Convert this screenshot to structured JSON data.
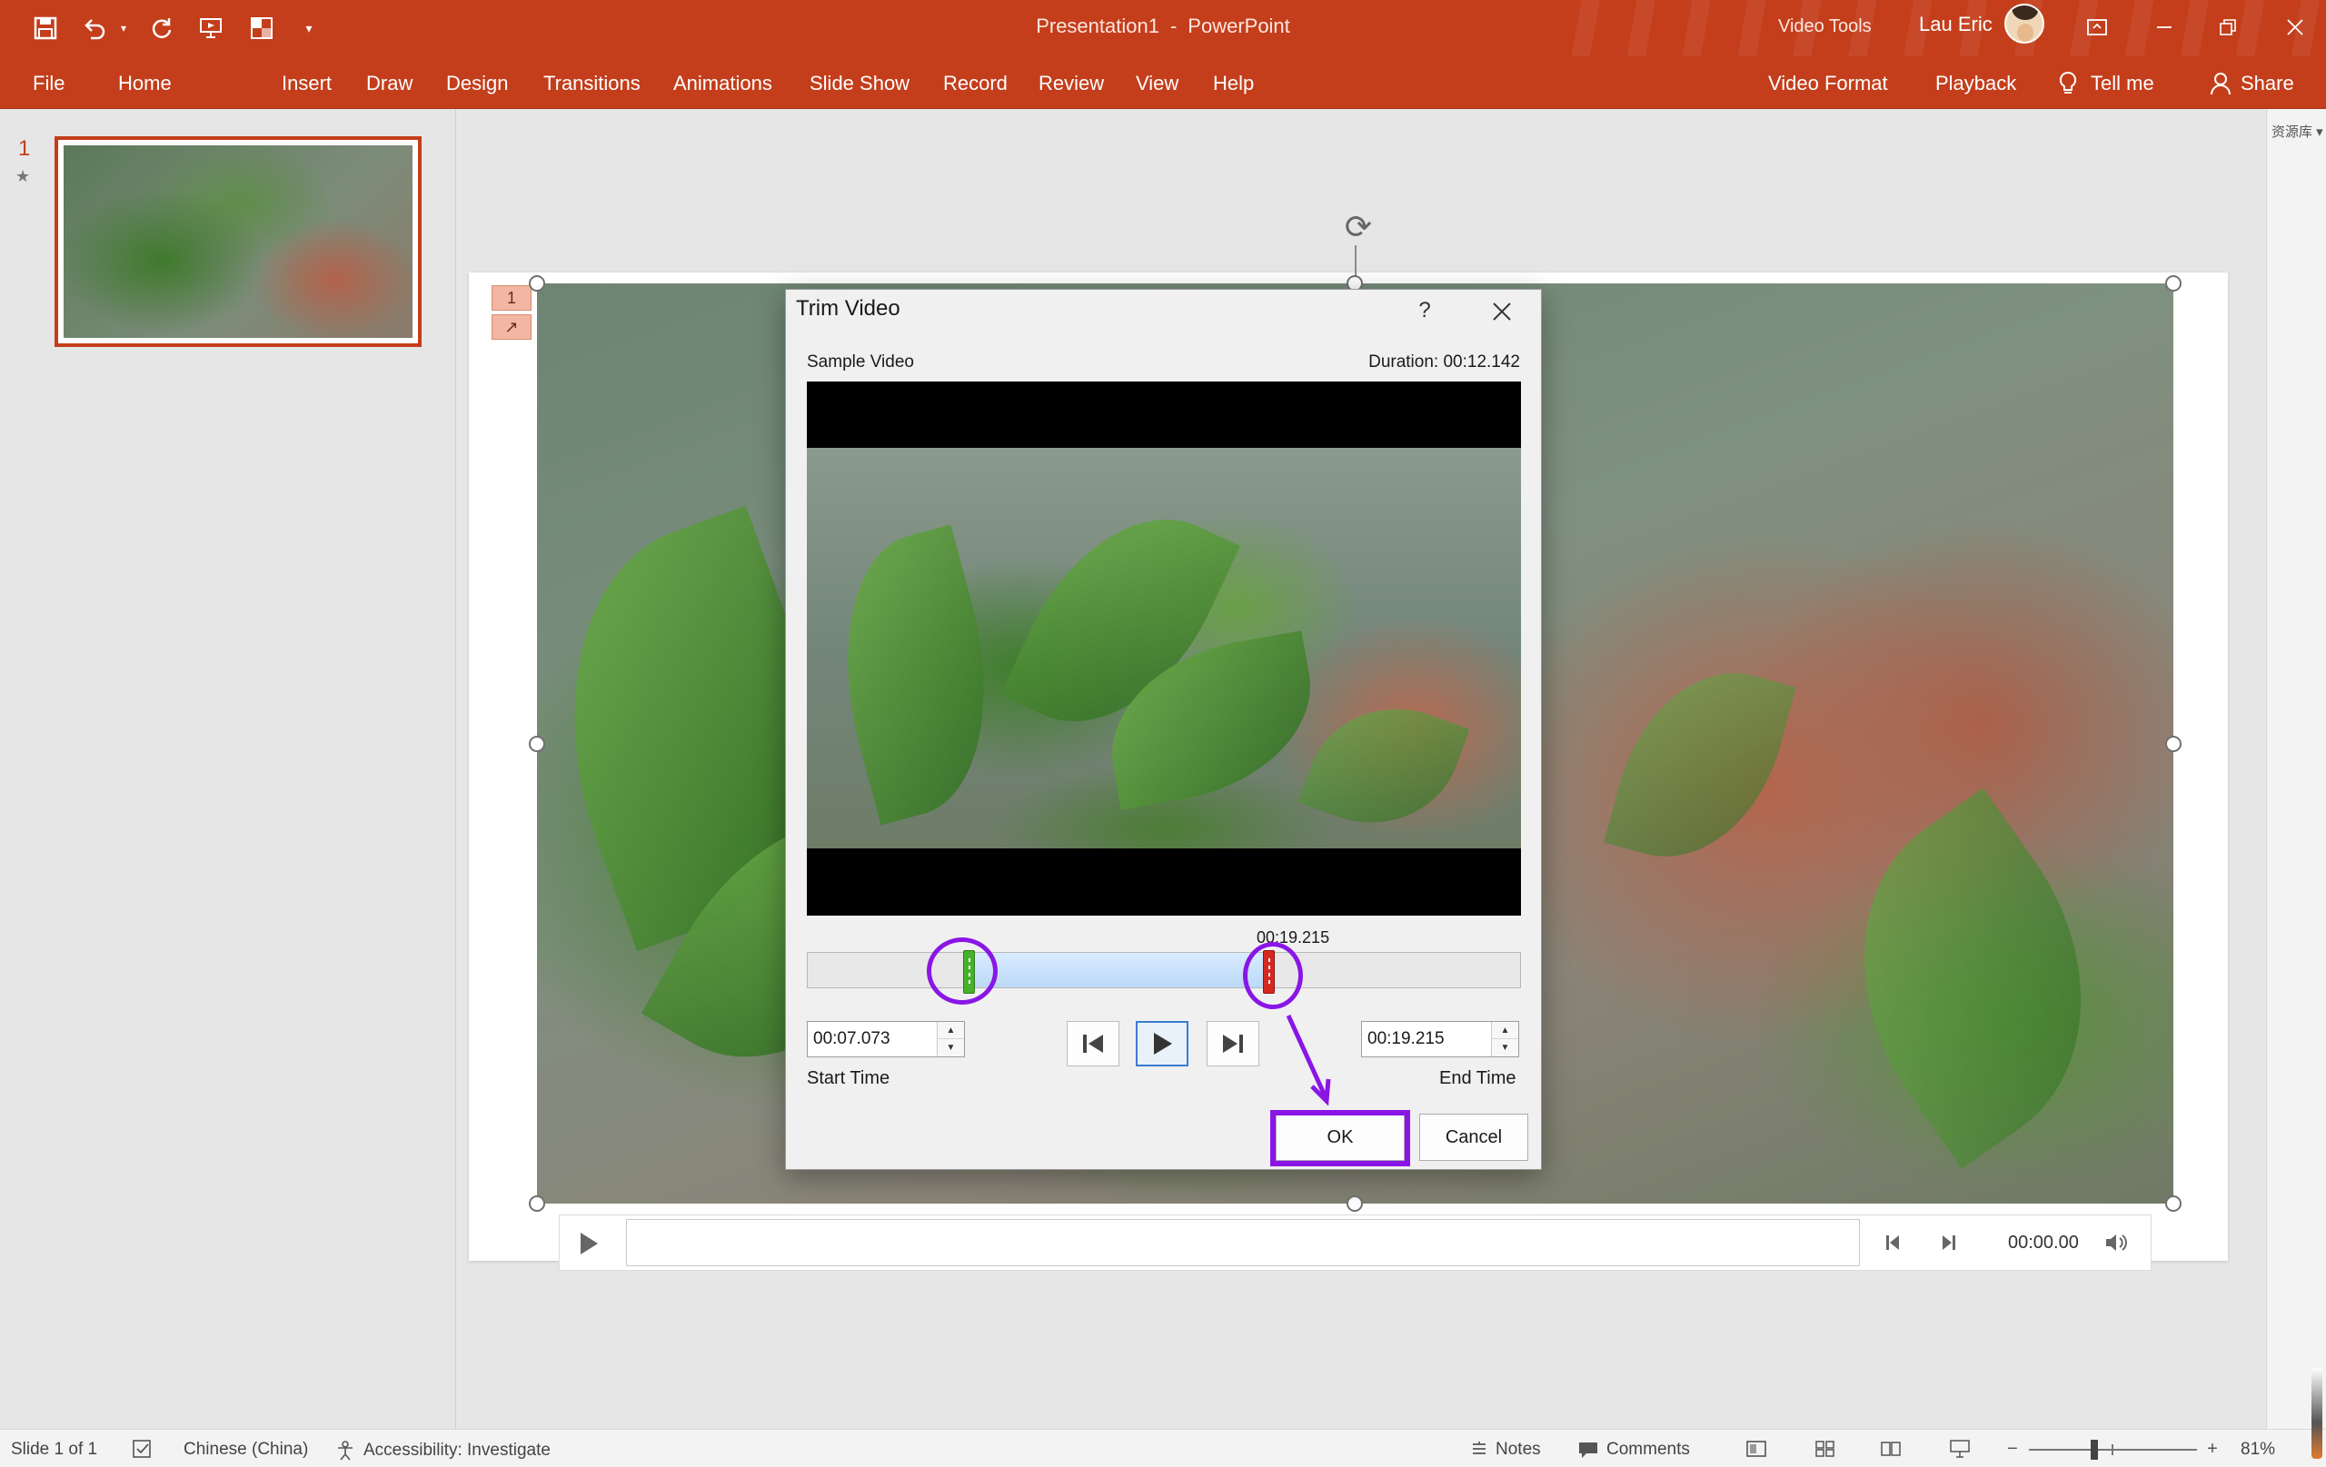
{
  "window": {
    "doc_name": "Presentation1",
    "separator": "-",
    "app_name": "PowerPoint",
    "context_label": "Video Tools",
    "user_name": "Lau Eric"
  },
  "ribbon": {
    "tabs": [
      "File",
      "Home",
      "Insert",
      "Draw",
      "Design",
      "Transitions",
      "Animations",
      "Slide Show",
      "Record",
      "Review",
      "View",
      "Help"
    ],
    "context_tabs": [
      "Video Format",
      "Playback"
    ],
    "tell_me": "Tell me",
    "share": "Share"
  },
  "thumbnails": {
    "slide_number": "1",
    "star": "★"
  },
  "right_rail": {
    "label": "资源库 ▾"
  },
  "slide": {
    "anim_tags": [
      "1",
      "↗"
    ]
  },
  "video_controls": {
    "time": "00:00.00"
  },
  "dialog": {
    "title": "Trim Video",
    "help": "?",
    "video_name": "Sample Video",
    "duration": "Duration: 00:12.142",
    "floating_time": "00:19.215",
    "start_time_value": "00:07.073",
    "end_time_value": "00:19.215",
    "start_label": "Start Time",
    "end_label": "End Time",
    "ok_label": "OK",
    "cancel_label": "Cancel"
  },
  "status_bar": {
    "slide_of": "Slide 1 of 1",
    "language": "Chinese (China)",
    "accessibility": "Accessibility: Investigate",
    "notes": "Notes",
    "comments": "Comments",
    "zoom": "81%"
  },
  "colors": {
    "ribbon": "#c43e1c",
    "highlight": "#8a16e6",
    "start_marker": "#46b12a",
    "end_marker": "#d6281f"
  }
}
